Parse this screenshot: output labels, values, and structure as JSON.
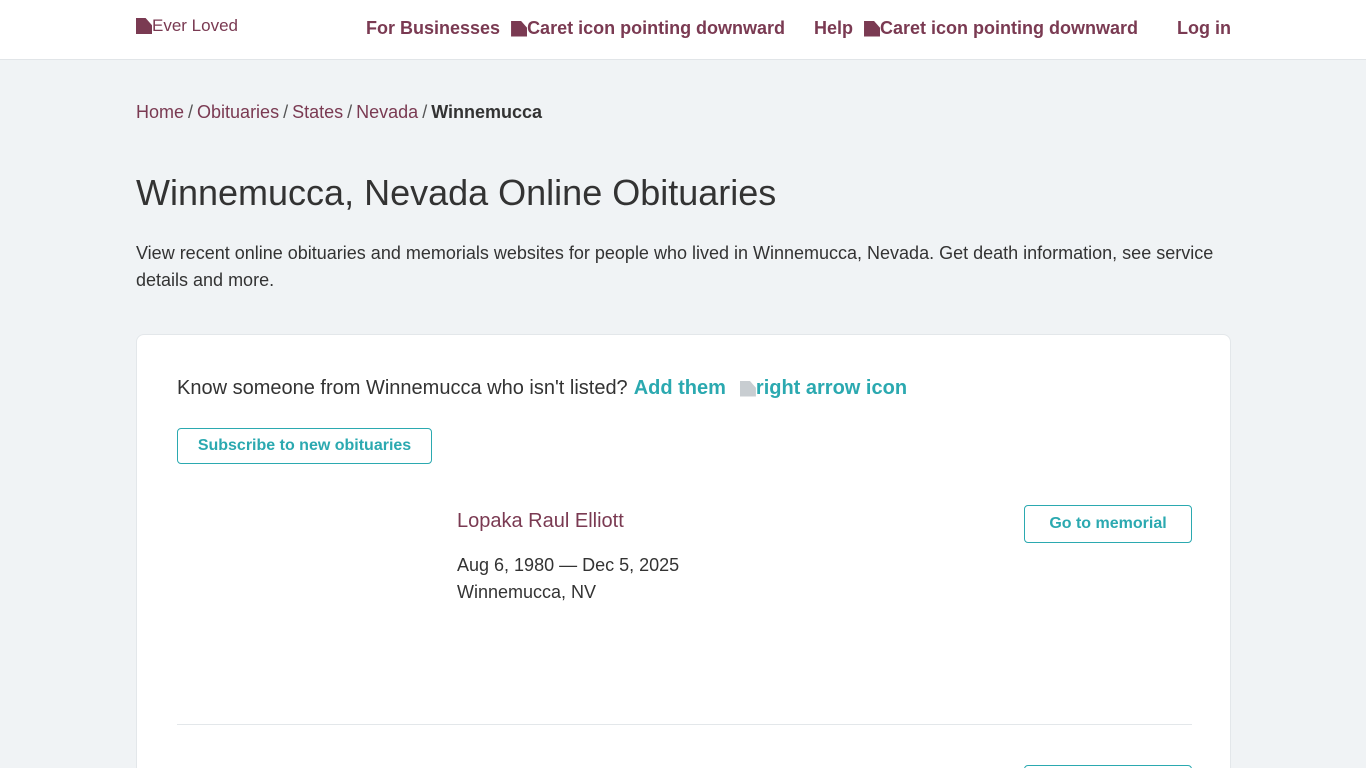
{
  "header": {
    "logo_alt": "Ever Loved",
    "nav": {
      "for_businesses": "For Businesses",
      "caret_alt_1": "Caret icon pointing downward",
      "help": "Help",
      "caret_alt_2": "Caret icon pointing downward",
      "login": "Log in"
    }
  },
  "breadcrumb": {
    "items": [
      "Home",
      "Obituaries",
      "States",
      "Nevada"
    ],
    "current": "Winnemucca",
    "separator": "/"
  },
  "page": {
    "title": "Winnemucca, Nevada Online Obituaries",
    "intro": "View recent online obituaries and memorials websites for people who lived in Winnemucca, Nevada. Get death information, see service details and more."
  },
  "card": {
    "know_text": "Know someone from Winnemucca who isn't listed?",
    "add_link": "Add them",
    "arrow_alt": "right arrow icon",
    "subscribe_label": "Subscribe to new obituaries",
    "entries": [
      {
        "name": "Lopaka Raul Elliott",
        "dates": "Aug 6, 1980 — Dec 5, 2025",
        "place": "Winnemucca, NV",
        "button": "Go to memorial"
      }
    ]
  },
  "colors": {
    "brand": "#7a3a52",
    "accent": "#2ba9b0",
    "background": "#f0f3f5"
  }
}
